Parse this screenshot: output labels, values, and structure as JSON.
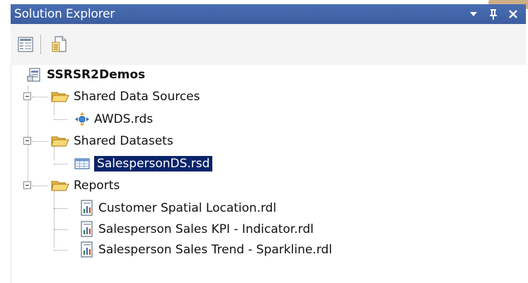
{
  "window": {
    "title": "Solution Explorer"
  },
  "title_controls": [
    {
      "name": "window-position-icon",
      "glyph": "▾"
    },
    {
      "name": "auto-hide-pin-icon",
      "glyph": "ꟷ"
    },
    {
      "name": "close-icon",
      "glyph": "✕"
    }
  ],
  "toolbar": {
    "buttons": [
      {
        "name": "properties-button"
      },
      {
        "name": "view-code-button"
      }
    ]
  },
  "tree": {
    "solution": {
      "label": "SSRSR2Demos"
    },
    "folders": [
      {
        "label": "Shared Data Sources",
        "items": [
          {
            "label": "AWDS.rds",
            "icon": "datasource-icon"
          }
        ]
      },
      {
        "label": "Shared Datasets",
        "items": [
          {
            "label": "SalespersonDS.rsd",
            "icon": "dataset-icon",
            "selected": true
          }
        ]
      },
      {
        "label": "Reports",
        "items": [
          {
            "label": "Customer Spatial Location.rdl",
            "icon": "report-icon"
          },
          {
            "label": "Salesperson Sales KPI - Indicator.rdl",
            "icon": "report-icon"
          },
          {
            "label": "Salesperson Sales Trend - Sparkline.rdl",
            "icon": "report-icon"
          }
        ]
      }
    ]
  },
  "colors": {
    "title_bar": "#3f62a6",
    "selection": "#0a246a",
    "folder": "#f2c75a"
  }
}
